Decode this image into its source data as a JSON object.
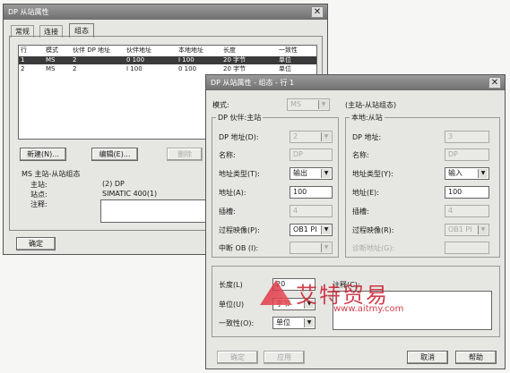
{
  "back_dialog": {
    "title": "DP 从站属性",
    "tabs": [
      "常规",
      "连接",
      "组态"
    ],
    "grid_headers": [
      "行",
      "模式",
      "伙伴 DP 地址",
      "伙伴地址",
      "本地地址",
      "长度",
      "一致性"
    ],
    "grid_rows": [
      [
        "1",
        "MS",
        "2",
        "0 100",
        "I 100",
        "20 字节",
        "单位"
      ],
      [
        "2",
        "MS",
        "2",
        "I 100",
        "0 100",
        "20 字节",
        "单位"
      ]
    ],
    "buttons": {
      "new": "新建(N)...",
      "edit": "编辑(E)...",
      "delete": "删除",
      "ok": "确定"
    },
    "info": {
      "heading": "MS 主站-从站组态",
      "master_label": "主站:",
      "master_value": "(2) DP",
      "station_label": "站点:",
      "station_value": "SIMATIC 400(1)",
      "comment_label": "注释:"
    }
  },
  "front_dialog": {
    "title": "DP 从站属性 - 组态 - 行 1",
    "mode_label": "模式:",
    "mode_value": "MS",
    "mode_note": "(主站-从站组态)",
    "partner": {
      "title": "DP 伙伴:主站",
      "dp_addr_label": "DP 地址(D):",
      "dp_addr_value": "2",
      "name_label": "名称:",
      "name_value": "DP",
      "addr_type_label": "地址类型(T):",
      "addr_type_value": "输出",
      "addr_label": "地址(A):",
      "addr_value": "100",
      "slot_label": "插槽:",
      "slot_value": "4",
      "process_image_label": "过程映像(P):",
      "process_image_value": "OB1 PI",
      "interrupt_ob_label": "中断 OB (I):",
      "interrupt_ob_value": ""
    },
    "local": {
      "title": "本地:从站",
      "dp_addr_label": "DP 地址:",
      "dp_addr_value": "3",
      "name_label": "名称:",
      "name_value": "DP",
      "addr_type_label": "地址类型(Y):",
      "addr_type_value": "输入",
      "addr_label": "地址(E):",
      "addr_value": "100",
      "slot_label": "插槽:",
      "slot_value": "4",
      "process_image_label": "过程映像(R):",
      "process_image_value": "OB1 PI",
      "diag_addr_label": "诊断地址(G):",
      "diag_addr_value": ""
    },
    "length_label": "长度(L)",
    "length_value": "20",
    "unit_label": "单位(U)",
    "unit_value": "字节",
    "consistency_label": "一致性(O):",
    "consistency_value": "单位",
    "comment_label": "注释(C):",
    "buttons": {
      "ok": "确定",
      "apply": "应用",
      "cancel": "取消",
      "help": "帮助"
    }
  },
  "watermark": {
    "brand": "艾特贸易",
    "url": "www.aitmy.com"
  }
}
